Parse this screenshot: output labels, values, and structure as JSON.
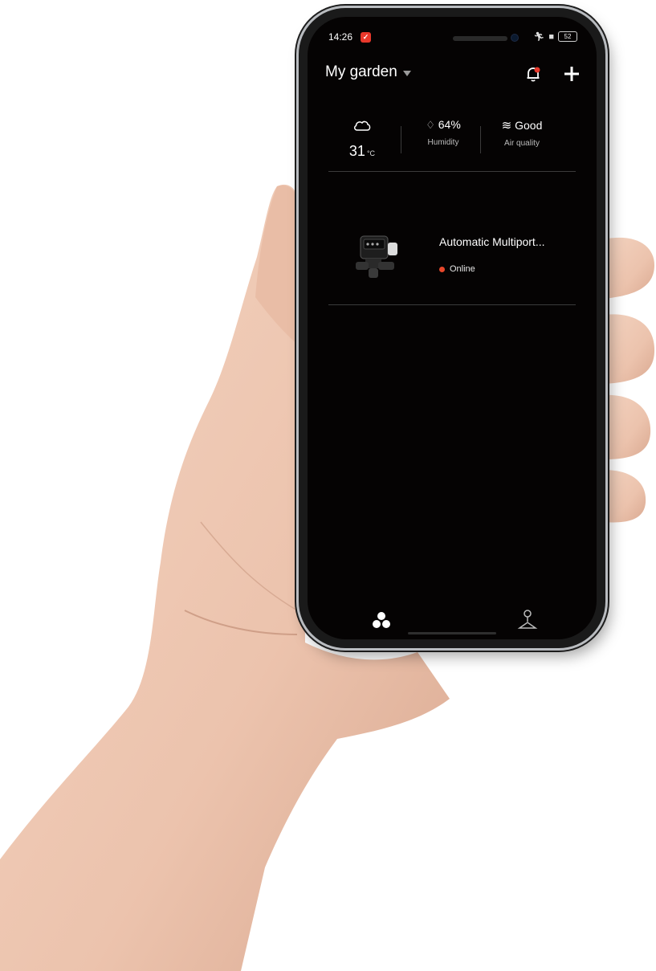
{
  "status_bar": {
    "time": "14:26",
    "battery": "52"
  },
  "header": {
    "title": "My garden"
  },
  "weather": {
    "temperature": "31",
    "temperature_unit": "°C",
    "humidity_value": "64%",
    "humidity_label": "Humidity",
    "air_quality_value": "Good",
    "air_quality_label": "Air quality"
  },
  "devices": [
    {
      "name": "Automatic Multiport...",
      "status": "Online"
    }
  ],
  "colors": {
    "screen_bg": "#050303",
    "status_online": "#e8472b",
    "notification_badge": "#e8382b"
  }
}
